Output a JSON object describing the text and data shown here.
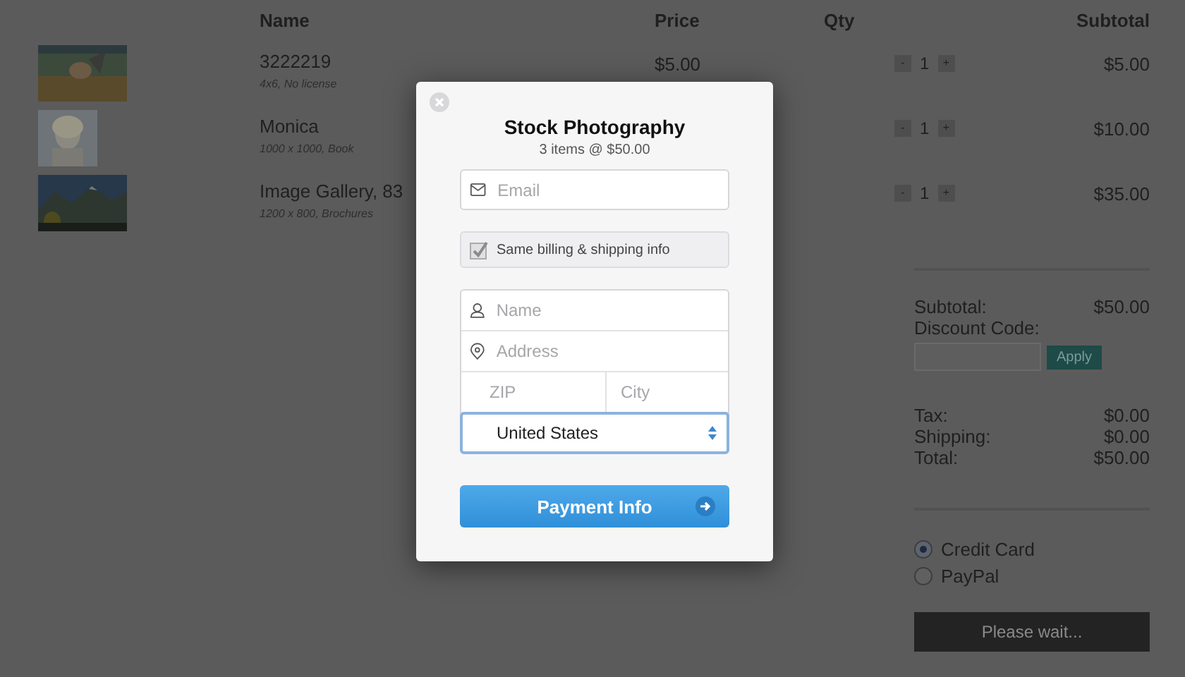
{
  "table": {
    "columns": [
      "Name",
      "Price",
      "Qty",
      "Subtotal"
    ],
    "rows": [
      {
        "name": "3222219",
        "details": "4x6, No license",
        "price": "$5.00",
        "decrement": "-",
        "qty": "1",
        "increment": "+",
        "subtotal": "$5.00"
      },
      {
        "name": "Monica",
        "details": "1000 x 1000, Book",
        "decrement": "-",
        "qty": "1",
        "increment": "+",
        "subtotal": "$10.00"
      },
      {
        "name": "Image Gallery, 83",
        "details": "1200 x 800, Brochures",
        "decrement": "-",
        "qty": "1",
        "increment": "+",
        "subtotal": "$35.00"
      }
    ]
  },
  "summary": {
    "subtotal_label": "Subtotal:",
    "subtotal": "$50.00",
    "discount_label": "Discount Code:",
    "apply": "Apply",
    "lines": [
      {
        "label": "Tax:",
        "value": "$0.00"
      },
      {
        "label": "Shipping:",
        "value": "$0.00"
      },
      {
        "label": "Total:",
        "value": "$50.00"
      }
    ],
    "payment_options": [
      {
        "label": "Credit Card",
        "selected": true
      },
      {
        "label": "PayPal",
        "selected": false
      }
    ],
    "submit": "Please wait..."
  },
  "dialog": {
    "title": "Stock Photography",
    "subtitle": "3 items @ $50.00",
    "email_placeholder": "Email",
    "same_info": {
      "label": "Same billing & shipping info",
      "checked": true
    },
    "name_placeholder": "Name",
    "address_placeholder": "Address",
    "zip_placeholder": "ZIP",
    "city_placeholder": "City",
    "country": "United States",
    "button": "Payment Info"
  }
}
